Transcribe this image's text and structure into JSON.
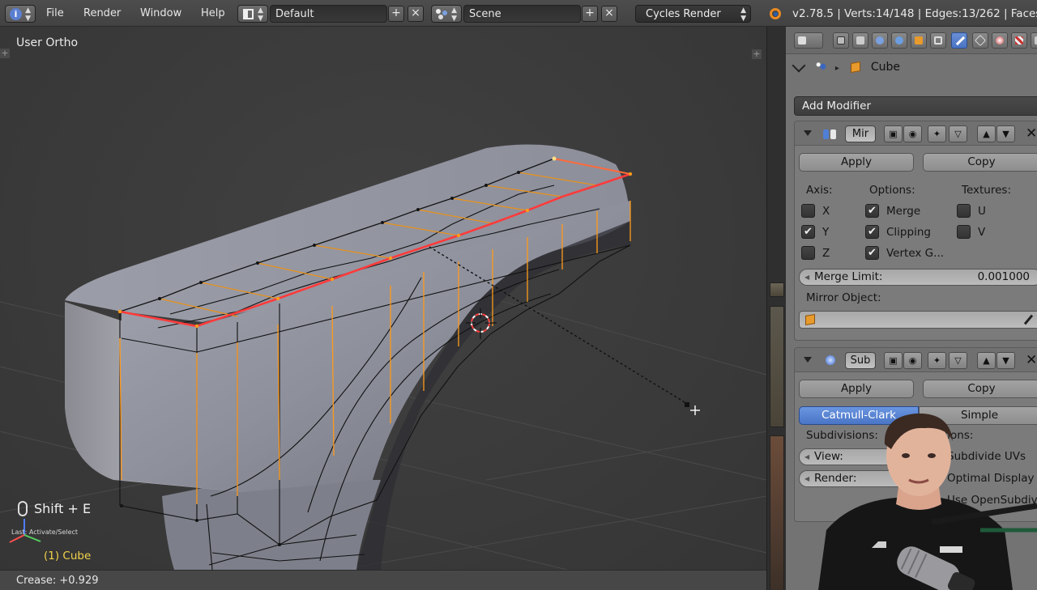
{
  "topbar": {
    "menus": [
      "File",
      "Render",
      "Window",
      "Help"
    ],
    "screen_layout": "Default",
    "scene": "Scene",
    "render_engine": "Cycles Render",
    "stats": "v2.78.5 | Verts:14/148 | Edges:13/262 | Faces:"
  },
  "viewport": {
    "view_name": "User Ortho",
    "key_hint": "Shift + E",
    "last_operator": "Last: Activate/Select",
    "object_label": "(1) Cube",
    "footer_status": "Crease: +0.929"
  },
  "properties": {
    "breadcrumb_object": "Cube",
    "add_modifier_label": "Add Modifier",
    "mirror": {
      "name": "Mir",
      "apply_label": "Apply",
      "copy_label": "Copy",
      "axis_label": "Axis:",
      "options_label": "Options:",
      "textures_label": "Textures:",
      "axis_x": "X",
      "axis_y": "Y",
      "axis_z": "Z",
      "merge": "Merge",
      "clipping": "Clipping",
      "vertex_groups": "Vertex G...",
      "tex_u": "U",
      "tex_v": "V",
      "merge_limit_label": "Merge Limit:",
      "merge_limit_value": "0.001000",
      "mirror_object_label": "Mirror Object:"
    },
    "subsurf": {
      "name": "Sub",
      "apply_label": "Apply",
      "copy_label": "Copy",
      "catmull_label": "Catmull-Clark",
      "simple_label": "Simple",
      "subdivisions_label": "Subdivisions:",
      "options_label_partial": "tions:",
      "view_label": "View:",
      "render_label": "Render:",
      "subdivide_uvs": "Subdivide UVs",
      "optimal_display": "Optimal Display",
      "use_opensubdiv": "Use OpenSubdiv"
    }
  },
  "colors": {
    "selected_edge": "#ff3b3b",
    "selected_vert": "#ff9a1a",
    "active_tab": "#4a74c4",
    "mesh_surface": "#8a8c98"
  }
}
